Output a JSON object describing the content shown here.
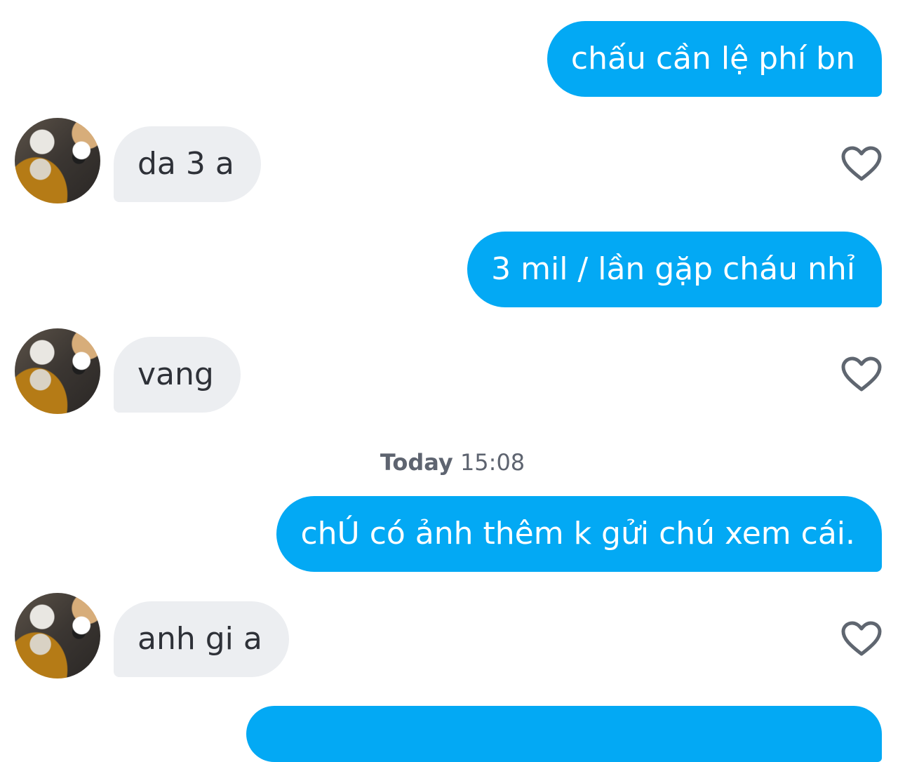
{
  "messages": [
    {
      "side": "sent",
      "text": "chấu cần lệ phí bn"
    },
    {
      "side": "received",
      "text": "da 3 a"
    },
    {
      "side": "sent",
      "text": "3 mil / lần gặp cháu nhỉ"
    },
    {
      "side": "received",
      "text": "vang"
    },
    {
      "side": "sent",
      "text": "chÚ có ảnh thêm k gửi chú xem cái."
    },
    {
      "side": "received",
      "text": "anh gi a"
    }
  ],
  "timestamp": {
    "day": "Today",
    "time": "15:08"
  },
  "icons": {
    "like": "heart-outline-icon",
    "avatar": "contact-avatar"
  },
  "colors": {
    "sent_bubble": "#03a9f4",
    "received_bubble": "#eceef1",
    "sent_text": "#ffffff",
    "received_text": "#2e3138",
    "timestamp_text": "#5e6470",
    "heart_stroke": "#5f6670"
  }
}
